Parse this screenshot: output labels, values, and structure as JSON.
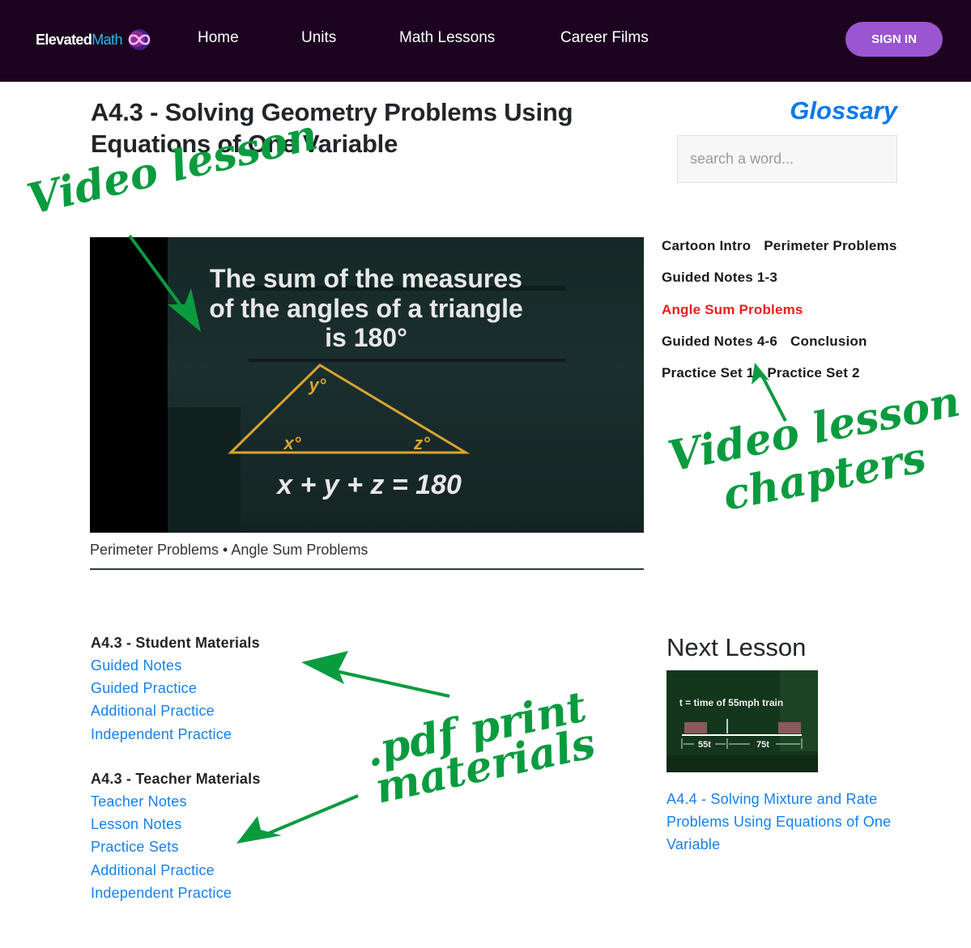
{
  "navbar": {
    "logo_part1": "Elevated",
    "logo_part2": "Math",
    "logo_icon": "infinity-icon",
    "links": [
      {
        "label": "Home"
      },
      {
        "label": "Units"
      },
      {
        "label": "Math Lessons"
      },
      {
        "label": "Career Films"
      }
    ],
    "signin_label": "SIGN IN"
  },
  "lesson": {
    "title": "A4.3 - Solving Geometry Problems Using Equations of One Variable",
    "video": {
      "line1": "The sum of the measures",
      "line2": "of the angles of a triangle",
      "line3": "is 180°",
      "angle_x": "x°",
      "angle_y": "y°",
      "angle_z": "z°",
      "equation": "x + y + z = 180"
    },
    "video_caption": "Perimeter Problems • Angle Sum Problems"
  },
  "glossary": {
    "title": "Glossary",
    "search_placeholder": "search a word..."
  },
  "chapters": {
    "rows": [
      [
        {
          "label": "Cartoon Intro",
          "active": false
        },
        {
          "label": "Perimeter Problems",
          "active": false
        }
      ],
      [
        {
          "label": "Guided Notes 1-3",
          "active": false
        }
      ],
      [
        {
          "label": "Angle Sum Problems",
          "active": true
        }
      ],
      [
        {
          "label": "Guided Notes 4-6",
          "active": false
        },
        {
          "label": "Conclusion",
          "active": false
        }
      ],
      [
        {
          "label": "Practice Set 1",
          "active": false
        },
        {
          "label": "Practice Set 2",
          "active": false
        }
      ]
    ]
  },
  "student_materials": {
    "heading": "A4.3 - Student Materials",
    "links": [
      "Guided Notes",
      "Guided Practice",
      "Additional Practice",
      "Independent Practice"
    ]
  },
  "teacher_materials": {
    "heading": "A4.3 - Teacher Materials",
    "links": [
      "Teacher Notes",
      "Lesson Notes",
      "Practice Sets",
      "Additional Practice",
      "Independent Practice"
    ]
  },
  "next_lesson": {
    "heading": "Next Lesson",
    "thumb_caption": "t = time of 55mph train",
    "thumb_left": "55t",
    "thumb_right": "75t",
    "link": "A4.4 - Solving Mixture and Rate Problems Using Equations of One Variable"
  },
  "annotations": {
    "video_lesson": "Video lesson",
    "chapters_line1": "Video lesson",
    "chapters_line2": "chapters",
    "pdf_line1": ".pdf print",
    "pdf_line2": "materials"
  },
  "colors": {
    "nav_bg": "#1c0420",
    "signin": "#9b55d0",
    "link": "#1580f0",
    "glossary": "#0b78f0",
    "active_chapter": "#ee1c1c",
    "annotation": "#0a9b3f"
  }
}
